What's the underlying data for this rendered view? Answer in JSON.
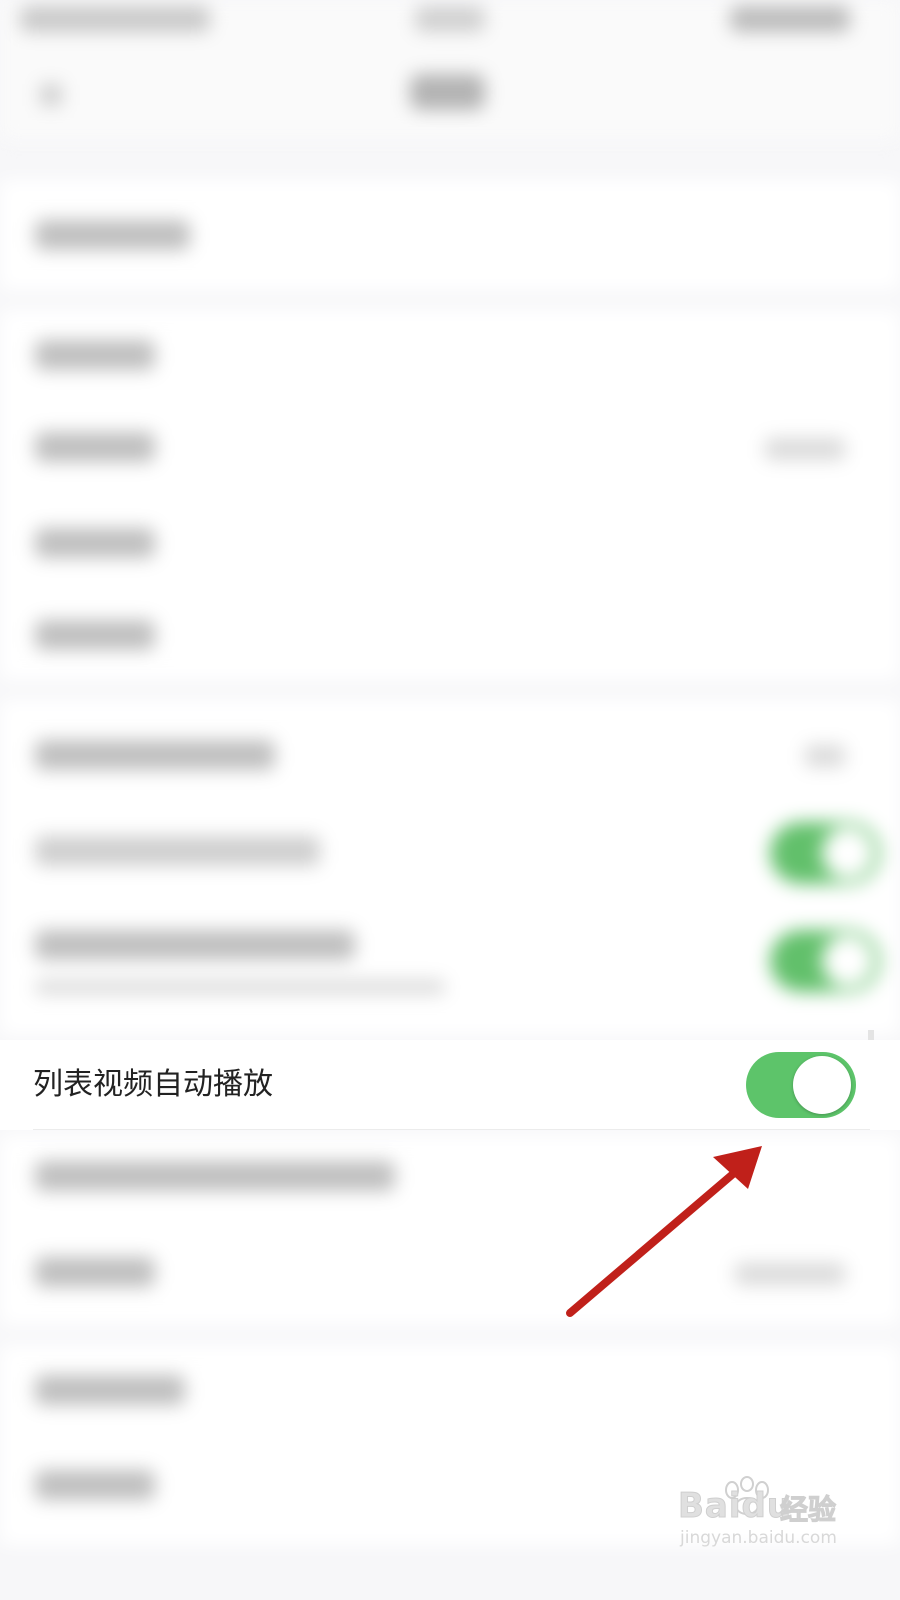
{
  "setting_row": {
    "label": "列表视频自动播放",
    "toggle_on": true,
    "toggle_color": "#5dc46a"
  },
  "annotation": {
    "arrow_color": "#c0201a",
    "icon": "arrow-annotation-icon"
  },
  "watermark": {
    "logo": "Baidu",
    "suffix": "经验",
    "url": "jingyan.baidu.com"
  }
}
